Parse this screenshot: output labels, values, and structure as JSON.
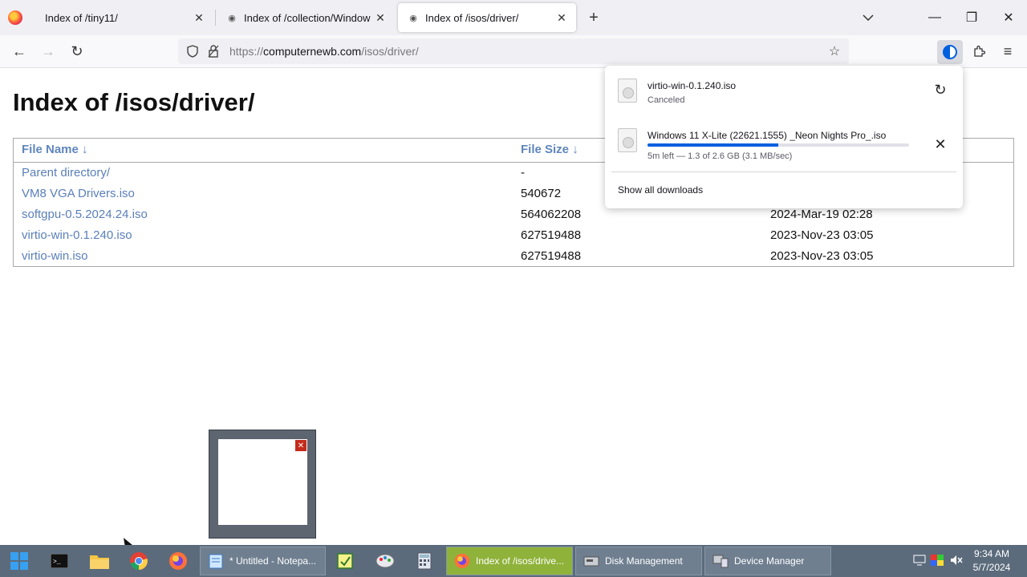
{
  "browser": {
    "tabs": [
      {
        "title": "Index of /tiny11/"
      },
      {
        "title": "Index of /collection/Windows"
      },
      {
        "title": "Index of /isos/driver/"
      }
    ],
    "url": {
      "scheme": "https://",
      "host": "computernewb.com",
      "path": "/isos/driver/"
    }
  },
  "page": {
    "title": "Index of /isos/driver/",
    "columns": {
      "name": "File Name  ↓",
      "size": "File Size  ↓"
    },
    "rows": [
      {
        "name": "Parent directory/",
        "size": "-",
        "date": ""
      },
      {
        "name": "VM8 VGA Drivers.iso",
        "size": "540672",
        "date": ""
      },
      {
        "name": "softgpu-0.5.2024.24.iso",
        "size": "564062208",
        "date": "2024-Mar-19 02:28"
      },
      {
        "name": "virtio-win-0.1.240.iso",
        "size": "627519488",
        "date": "2023-Nov-23 03:05"
      },
      {
        "name": "virtio-win.iso",
        "size": "627519488",
        "date": "2023-Nov-23 03:05"
      }
    ]
  },
  "downloads": {
    "items": [
      {
        "name": "virtio-win-0.1.240.iso",
        "status": "Canceled",
        "action_icon": "retry-icon"
      },
      {
        "name": "Windows 11 X-Lite (22621.1555) _Neon Nights Pro_.iso",
        "status": "5m left — 1.3 of 2.6 GB (3.1 MB/sec)",
        "progress": 0.5,
        "action_icon": "cancel-icon"
      }
    ],
    "show_all": "Show all downloads"
  },
  "taskbar": {
    "buttons": [
      {
        "label": "* Untitled - Notepa..."
      },
      {
        "label": "Index of /isos/drive..."
      },
      {
        "label": "Disk Management"
      },
      {
        "label": "Device Manager"
      }
    ],
    "time": "9:34 AM",
    "date": "5/7/2024"
  },
  "colors": {
    "accent": "#0060df",
    "link": "#5a7fb9",
    "taskbar": "#5b6b7c",
    "active_task": "#8fb23a"
  }
}
